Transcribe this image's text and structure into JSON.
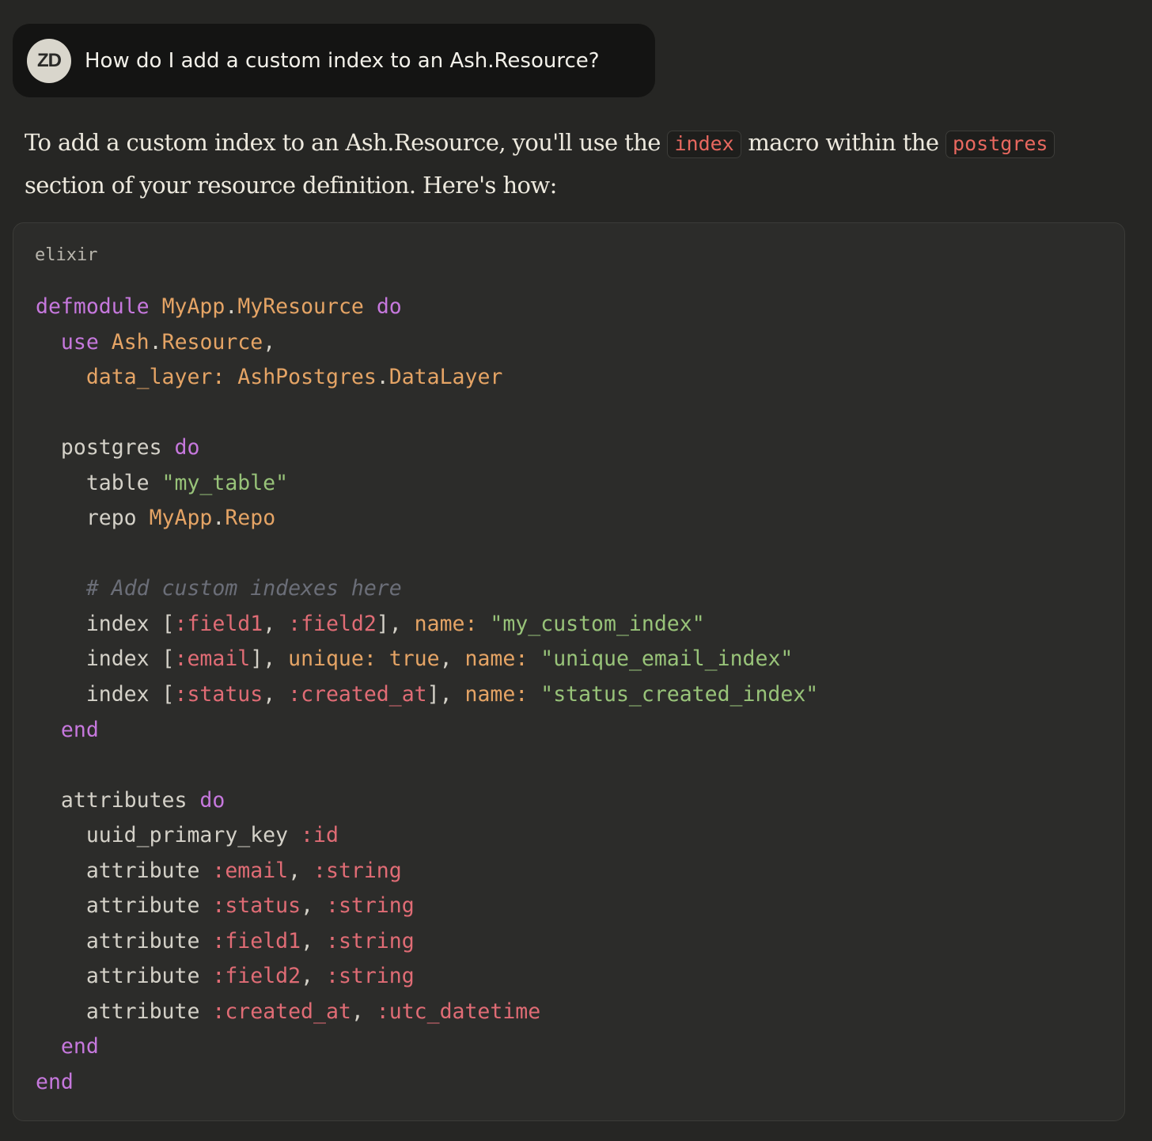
{
  "user_message": {
    "avatar_initials": "ZD",
    "text": "How do I add a custom index to an Ash.Resource?"
  },
  "answer": {
    "part1": "To add a custom index to an Ash.Resource, you'll use the ",
    "code1": "index",
    "part2": " macro within the ",
    "code2": "postgres",
    "part3": " section of your resource definition. Here's how:"
  },
  "code_block": {
    "language": "elixir",
    "lines": [
      [
        [
          "kw",
          "defmodule"
        ],
        [
          "plain",
          " "
        ],
        [
          "mod",
          "MyApp"
        ],
        [
          "plain",
          "."
        ],
        [
          "mod",
          "MyResource"
        ],
        [
          "plain",
          " "
        ],
        [
          "kw",
          "do"
        ]
      ],
      [
        [
          "plain",
          "  "
        ],
        [
          "kw",
          "use"
        ],
        [
          "plain",
          " "
        ],
        [
          "mod",
          "Ash"
        ],
        [
          "plain",
          "."
        ],
        [
          "mod",
          "Resource"
        ],
        [
          "plain",
          ","
        ]
      ],
      [
        [
          "plain",
          "    "
        ],
        [
          "key",
          "data_layer:"
        ],
        [
          "plain",
          " "
        ],
        [
          "mod",
          "AshPostgres"
        ],
        [
          "plain",
          "."
        ],
        [
          "mod",
          "DataLayer"
        ]
      ],
      [],
      [
        [
          "plain",
          "  postgres "
        ],
        [
          "kw",
          "do"
        ]
      ],
      [
        [
          "plain",
          "    table "
        ],
        [
          "str",
          "\"my_table\""
        ]
      ],
      [
        [
          "plain",
          "    repo "
        ],
        [
          "mod",
          "MyApp"
        ],
        [
          "plain",
          "."
        ],
        [
          "mod",
          "Repo"
        ]
      ],
      [],
      [
        [
          "plain",
          "    "
        ],
        [
          "cmt",
          "# Add custom indexes here"
        ]
      ],
      [
        [
          "plain",
          "    index ["
        ],
        [
          "atom",
          ":field1"
        ],
        [
          "plain",
          ", "
        ],
        [
          "atom",
          ":field2"
        ],
        [
          "plain",
          "], "
        ],
        [
          "key",
          "name:"
        ],
        [
          "plain",
          " "
        ],
        [
          "str",
          "\"my_custom_index\""
        ]
      ],
      [
        [
          "plain",
          "    index ["
        ],
        [
          "atom",
          ":email"
        ],
        [
          "plain",
          "], "
        ],
        [
          "key",
          "unique:"
        ],
        [
          "plain",
          " "
        ],
        [
          "bool",
          "true"
        ],
        [
          "plain",
          ", "
        ],
        [
          "key",
          "name:"
        ],
        [
          "plain",
          " "
        ],
        [
          "str",
          "\"unique_email_index\""
        ]
      ],
      [
        [
          "plain",
          "    index ["
        ],
        [
          "atom",
          ":status"
        ],
        [
          "plain",
          ", "
        ],
        [
          "atom",
          ":created_at"
        ],
        [
          "plain",
          "], "
        ],
        [
          "key",
          "name:"
        ],
        [
          "plain",
          " "
        ],
        [
          "str",
          "\"status_created_index\""
        ]
      ],
      [
        [
          "plain",
          "  "
        ],
        [
          "kw",
          "end"
        ]
      ],
      [],
      [
        [
          "plain",
          "  attributes "
        ],
        [
          "kw",
          "do"
        ]
      ],
      [
        [
          "plain",
          "    uuid_primary_key "
        ],
        [
          "atom",
          ":id"
        ]
      ],
      [
        [
          "plain",
          "    attribute "
        ],
        [
          "atom",
          ":email"
        ],
        [
          "plain",
          ", "
        ],
        [
          "atom",
          ":string"
        ]
      ],
      [
        [
          "plain",
          "    attribute "
        ],
        [
          "atom",
          ":status"
        ],
        [
          "plain",
          ", "
        ],
        [
          "atom",
          ":string"
        ]
      ],
      [
        [
          "plain",
          "    attribute "
        ],
        [
          "atom",
          ":field1"
        ],
        [
          "plain",
          ", "
        ],
        [
          "atom",
          ":string"
        ]
      ],
      [
        [
          "plain",
          "    attribute "
        ],
        [
          "atom",
          ":field2"
        ],
        [
          "plain",
          ", "
        ],
        [
          "atom",
          ":string"
        ]
      ],
      [
        [
          "plain",
          "    attribute "
        ],
        [
          "atom",
          ":created_at"
        ],
        [
          "plain",
          ", "
        ],
        [
          "atom",
          ":utc_datetime"
        ]
      ],
      [
        [
          "plain",
          "  "
        ],
        [
          "kw",
          "end"
        ]
      ],
      [
        [
          "kw",
          "end"
        ]
      ]
    ]
  }
}
